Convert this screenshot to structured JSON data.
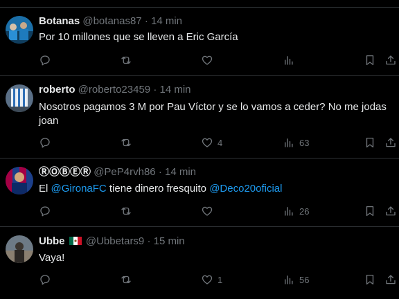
{
  "tweets": [
    {
      "name": "Botanas",
      "handle": "@botanas87",
      "dot": "·",
      "time": "14 min",
      "text": "Por 10 millones que se lleven a Eric García",
      "likes": "",
      "views": ""
    },
    {
      "name": "roberto",
      "handle": "@roberto23459",
      "dot": "·",
      "time": "14 min",
      "text": "Nosotros pagamos 3 M por Pau Víctor y se lo vamos a ceder? No me jodas joan",
      "likes": "4",
      "views": "63"
    },
    {
      "name": "ⓇⓄⒷⒺⓇ",
      "handle": "@PeP4rvh86",
      "dot": "·",
      "time": "14 min",
      "text_pre": "El ",
      "mention1": "@GironaFC",
      "text_mid": " tiene dinero fresquito ",
      "mention2": "@Deco20oficial",
      "likes": "",
      "views": "26"
    },
    {
      "name": "Ubbe",
      "handle": "@Ubbetars9",
      "dot": "·",
      "time": "15 min",
      "text": "Vaya!",
      "likes": "1",
      "views": "56"
    }
  ],
  "colors": {
    "background": "#000000",
    "text": "#e7e9ea",
    "muted": "#71767b",
    "link": "#1d9bf0",
    "divider": "#2f3336"
  }
}
